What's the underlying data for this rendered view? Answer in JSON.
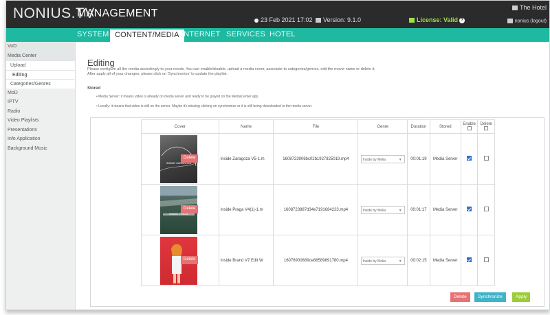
{
  "header": {
    "logo": "NONIUS.TV",
    "title": "MANAGEMENT",
    "date": "23 Feb 2021 17:02",
    "version": "Version: 9.1.0",
    "license": "License: Valid",
    "hotel": "The Hotel",
    "user": "nonius (logout)"
  },
  "nav": {
    "tabs": [
      {
        "label": "SYSTEM"
      },
      {
        "label": "CONTENT/MEDIA"
      },
      {
        "label": "INTERNET"
      },
      {
        "label": "SERVICES"
      },
      {
        "label": "HOTEL"
      }
    ]
  },
  "sidebar": {
    "items": [
      {
        "label": "VoD"
      },
      {
        "label": "Media Center"
      },
      {
        "label": "Upload"
      },
      {
        "label": "Editing"
      },
      {
        "label": "Categories/Genres"
      },
      {
        "label": "MoD"
      },
      {
        "label": "IPTV"
      },
      {
        "label": "Radio"
      },
      {
        "label": "Video Playlists"
      },
      {
        "label": "Presentations"
      },
      {
        "label": "Info Application"
      },
      {
        "label": "Background Music"
      }
    ]
  },
  "main": {
    "heading": "Editing",
    "desc1": "Please configure all the media accordingly to your needs. You can enable/disable, upload a media cover, associate to categories/genres, edit the movie name or delete it.",
    "desc2": "After apply all of your changes, please click on 'Synchronize' to update the playlist.",
    "stored_title": "Stored",
    "bullet1": "• Media Server: it means video is already on media server and ready to be played on the MediaCenter app.",
    "bullet2": "• Locally: it means that video is still on the server. Maybe it's missing clicking on synchronize or it is still being downloaded to the media server."
  },
  "table": {
    "headers": {
      "cover": "Cover",
      "name": "Name",
      "file": "File",
      "genre": "Genre",
      "duration": "Duration",
      "stored": "Stored",
      "enable": "Enable",
      "delete": "Delete"
    },
    "rows": [
      {
        "cover_text": "INSIDE ZARAGOZA",
        "delete_label": "Delete",
        "name": "Inside Zaragoza V5-1.m",
        "file": "1608723906bc02b1927825019.mp4",
        "genre": "Inside by Melia",
        "duration": "00:01:19",
        "stored": "Media Server",
        "enabled": true,
        "delete_checked": false
      },
      {
        "cover_text": "INSIDE PRAGA",
        "delete_label": "Delete",
        "name": "Inside Praga V4(1)-1.m",
        "file": "1608723887d34e7191684223.mp4",
        "genre": "Inside by Melia",
        "duration": "00:01:17",
        "stored": "Media Server",
        "enabled": true,
        "delete_checked": false
      },
      {
        "cover_text": "",
        "delete_label": "Delete",
        "name": "Inside Brand V7 Edit W",
        "file": "16076900889ce88589891780.mp4",
        "genre": "Inside by Melia",
        "duration": "00:02:15",
        "stored": "Media Server",
        "enabled": true,
        "delete_checked": false
      }
    ]
  },
  "actions": {
    "delete": "Delete",
    "synchronize": "Synchronize",
    "apply": "Apply"
  },
  "colors": {
    "topbar": "#2b2b2b",
    "nav": "#1fb8a0",
    "delete": "#e57373",
    "synchronize": "#3fb3c8",
    "apply": "#9ccc3a",
    "license": "#9be24a"
  }
}
